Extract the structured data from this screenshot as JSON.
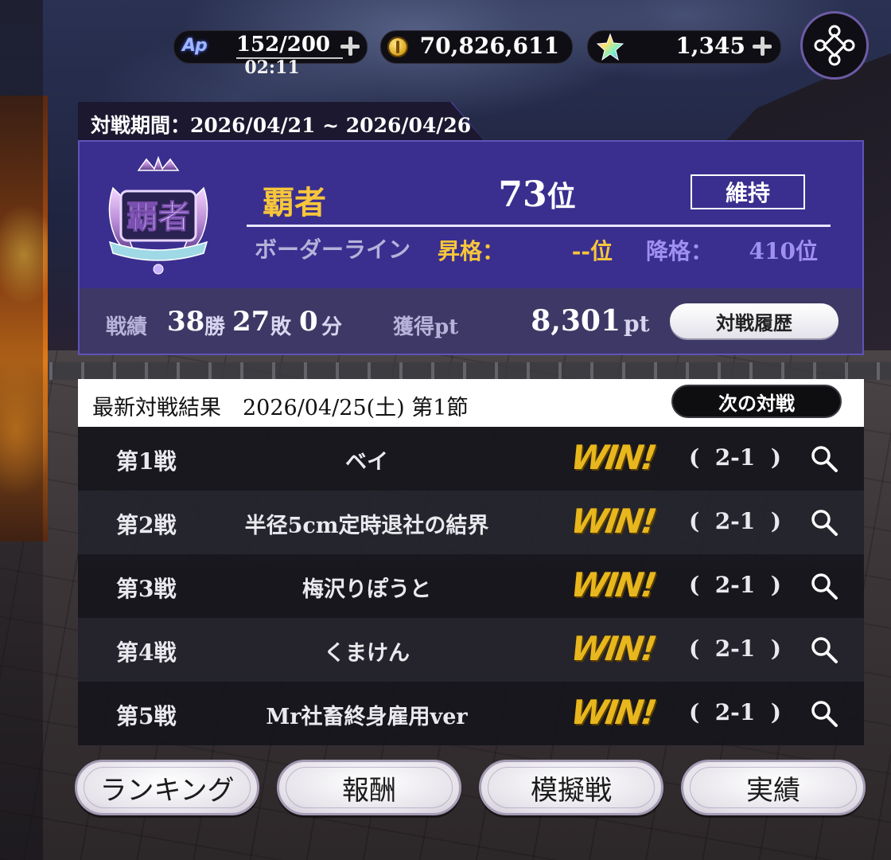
{
  "resources": {
    "ap_logo": "Ap",
    "ap_value": "152/200",
    "ap_timer": "02:11",
    "coins": "70,826,611",
    "gems": "1,345"
  },
  "season": {
    "period": "対戦期間：2026/04/21 ~ 2026/04/26",
    "rank_name": "覇者",
    "rank_position": "73",
    "rank_position_unit": "位",
    "status": "維持",
    "border_label": "ボーダーライン",
    "promotion_label": "昇格：",
    "promotion_value": "--位",
    "demotion_label": "降格：",
    "demotion_value": "410位"
  },
  "record": {
    "label": "戦績",
    "wins": "38",
    "wins_unit": "勝",
    "losses": "27",
    "losses_unit": "敗",
    "draws": "0",
    "draws_unit": "分",
    "points_label": "獲得pt",
    "points_value": "8,301",
    "points_unit": "pt",
    "history_button": "対戦履歴"
  },
  "latest": {
    "title": "最新対戦結果　2026/04/25(土) 第1節",
    "next_button": "次の対戦",
    "matches": [
      {
        "no": "第1戦",
        "opponent": "ベイ",
        "result": "WIN!",
        "score": "(  2-1  )"
      },
      {
        "no": "第2戦",
        "opponent": "半径5cm定時退社の結界",
        "result": "WIN!",
        "score": "(  2-1  )"
      },
      {
        "no": "第3戦",
        "opponent": "梅沢りぽうと",
        "result": "WIN!",
        "score": "(  2-1  )"
      },
      {
        "no": "第4戦",
        "opponent": "くまけん",
        "result": "WIN!",
        "score": "(  2-1  )"
      },
      {
        "no": "第5戦",
        "opponent": "Mr社畜終身雇用ver",
        "result": "WIN!",
        "score": "(  2-1  )"
      }
    ]
  },
  "bottom_nav": {
    "ranking": "ランキング",
    "rewards": "報酬",
    "mock_battle": "模擬戦",
    "achievements": "実績"
  },
  "colors": {
    "panel_purple": "#3a2f8f",
    "rank_gold": "#f7c63b",
    "demotion_violet": "#9f8ff0",
    "win_gold": "#e8b71e"
  }
}
